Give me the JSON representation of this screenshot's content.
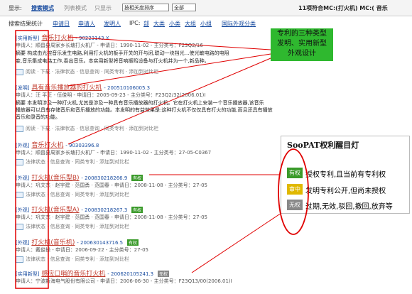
{
  "topbar": {
    "display_label": "显示:",
    "mode_search": "搜索模式",
    "mode_list": "列表模式",
    "mode_only": "只显示",
    "sort_value": "按相关度排序",
    "filter_value": "全部",
    "result_summary": "11项符合MC:(打火机) MC:( 音乐"
  },
  "stats": {
    "label": "搜索结果统计",
    "items": [
      "申请日",
      "申请人",
      "发明人",
      "IPC:",
      "部",
      "大类",
      "小类",
      "大组",
      "小组",
      "国际外观分类"
    ]
  },
  "callout": {
    "text": "专利的三种类型\n发明、实用新型\n外观设计"
  },
  "records": [
    {
      "type": "[实用新型]",
      "title": "音乐打火机",
      "number": "- 90223143.X",
      "meta": "申请人：顺昌县周家乡长塘打火机厂 - 申请日：1990-11-02 - 主分类号：F23Q2/16",
      "abstract_1": "摘要 构成由光控音乐发生电路,利用打火机的板手开关的开与闭,联动一块挡光…使光敏电路的电阻",
      "abstract_2": "变,音乐集成电路工作,奏出音乐。本实用新型将音响振鸣设备与打火机并为一个,新品种。",
      "ops": "阅读 · 下载 · 法律状态 · 信息查询 · 同类专利 · 添加到对比栏"
    },
    {
      "type": "[发明]",
      "title": "具有音乐播放器的打火机",
      "number": "- 200510106005.3",
      "meta": "申请人：汪 平正 - 伍俊明 - 申请日：2005-09-23 - 主分类号：F23Q2/32(2006.01)I",
      "abstract_1": "摘要 本发明涉及一种打火机,尤其是涉及一种具有音乐播放器的打火机。它在打火机上安装一个音乐播放器,该音乐",
      "abstract_2": "播放器可以具有存储音乐和音乐播放的功能。本发明的有益效果是:这种打火机不仅仅具有打火的功能,而且还具有播放",
      "abstract_3": "音乐和录音的功能。",
      "ops": "阅读 · 下载 · 法律状态 · 信息查询 · 同类专利 · 添加到对比栏"
    },
    {
      "type": "[外观]",
      "title": "音乐打火机",
      "number": "- 90303396.8",
      "meta": "申请人：顺昌县周家乡长塘打火机厂 - 申请日：1990-11-02 - 主分类号：27-05-C0367",
      "ops": "法律状态 · 信息查询 · 同类专利 · 添加到对比栏"
    },
    {
      "type": "[外观]",
      "title": "打火机(音乐型B)",
      "number": "- 200830218266.9",
      "badge": "有权",
      "meta": "申请人：巩文杰 · 赵宇建 · 范国勇 · 范国春 - 申请日：2008-11-08 - 主分类号：27-05",
      "ops": "法律状态 · 信息查询 · 同类专利 · 添加到对比栏"
    },
    {
      "type": "[外观]",
      "title": "打火机(音乐型A)",
      "number": "- 200830218267.3",
      "badge": "有权",
      "meta": "申请人：巩文杰 · 赵宇建 · 范国勇 · 范国春 - 申请日：2008-11-08 - 主分类号：27-05",
      "ops": "法律状态 · 信息查询 · 同类专利 · 添加到对比栏"
    },
    {
      "type": "[外观]",
      "title": "打火机(音乐机)",
      "number": "- 200630143716.5",
      "badge": "有权",
      "meta": "申请人：戴俊操 - 申请日：2006-09-22 - 主分类号：27-05",
      "ops": "法律状态 · 信息查询 · 同类专利 · 添加到对比栏"
    },
    {
      "type": "[实用新型]",
      "title": "感应口哨的音乐打火机",
      "number": "- 200620105241.3",
      "badge": "无权",
      "meta": "申请人：宁波新海电气股份有限公司 - 申请日：2006-06-30 - 主分类号：F23Q13/00(2006.01)I",
      "ops": ""
    }
  ],
  "legend": {
    "title": "SooPAT权利醒目灯",
    "rows": [
      {
        "tag": "有权",
        "text": "授权专利,且当前有专利权",
        "color": "#3a9a2a"
      },
      {
        "tag": "审中",
        "text": "发明专利公开,但尚未授权",
        "color": "#e0b800"
      },
      {
        "tag": "无权",
        "text": "过期,无效,驳回,撤回,放弃等",
        "color": "#888888"
      }
    ]
  },
  "colors": {
    "annotation_red": "#e00000",
    "link_blue": "#1a4da0",
    "title_red": "#c0392b",
    "callout_green": "#2fb82f"
  }
}
